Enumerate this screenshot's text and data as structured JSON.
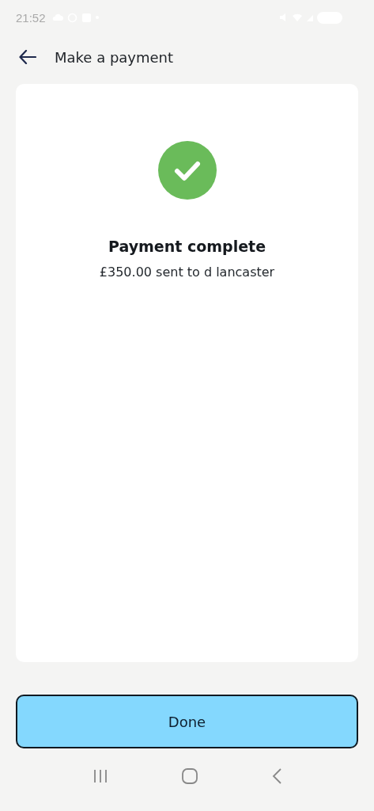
{
  "status_bar": {
    "time": "21:52"
  },
  "header": {
    "title": "Make a payment"
  },
  "result": {
    "kind": "success",
    "title": "Payment complete",
    "message": "£350.00 sent to d lancaster"
  },
  "buttons": [
    {
      "label": "Done"
    }
  ]
}
